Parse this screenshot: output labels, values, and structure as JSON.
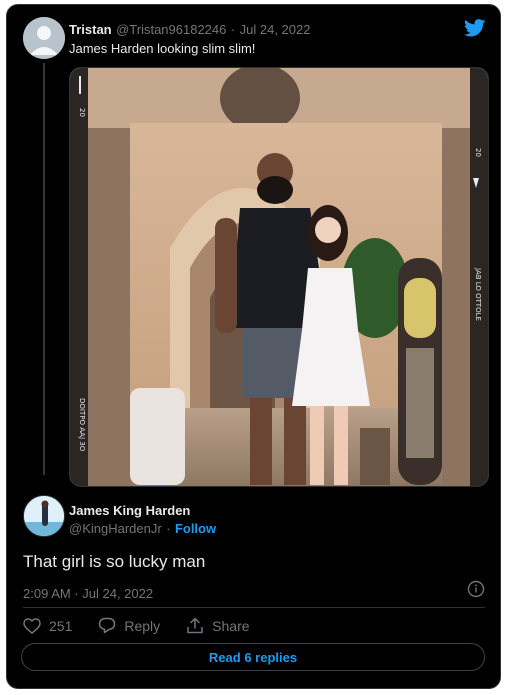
{
  "reply_context": {
    "author_name": "Tristan",
    "author_handle": "@Tristan96182246",
    "separator": "·",
    "date": "Jul 24, 2022",
    "text": "James Harden looking slim slim!"
  },
  "tweet": {
    "author_name": "James King Harden",
    "author_handle": "@KingHardenJr",
    "separator": "·",
    "follow_label": "Follow",
    "text": "That girl is so lucky man",
    "timestamp": "2:09 AM · Jul 24, 2022",
    "like_count": "251",
    "reply_label": "Reply",
    "share_label": "Share",
    "read_replies_label": "Read 6 replies"
  },
  "photo": {
    "film_edge_text_left": "20",
    "film_edge_text_left_2": "DOITPO AAJ 3O",
    "film_edge_text_right": "20",
    "film_edge_text_right_2": "JAB LO OTTOLE"
  },
  "colors": {
    "background": "#000000",
    "text_primary": "#e7e9ea",
    "text_secondary": "#71767b",
    "accent_blue": "#1d9bf0",
    "border": "#2f3336"
  },
  "icons": [
    "twitter-bird-icon",
    "heart-icon",
    "reply-bubble-icon",
    "share-icon",
    "info-icon"
  ]
}
